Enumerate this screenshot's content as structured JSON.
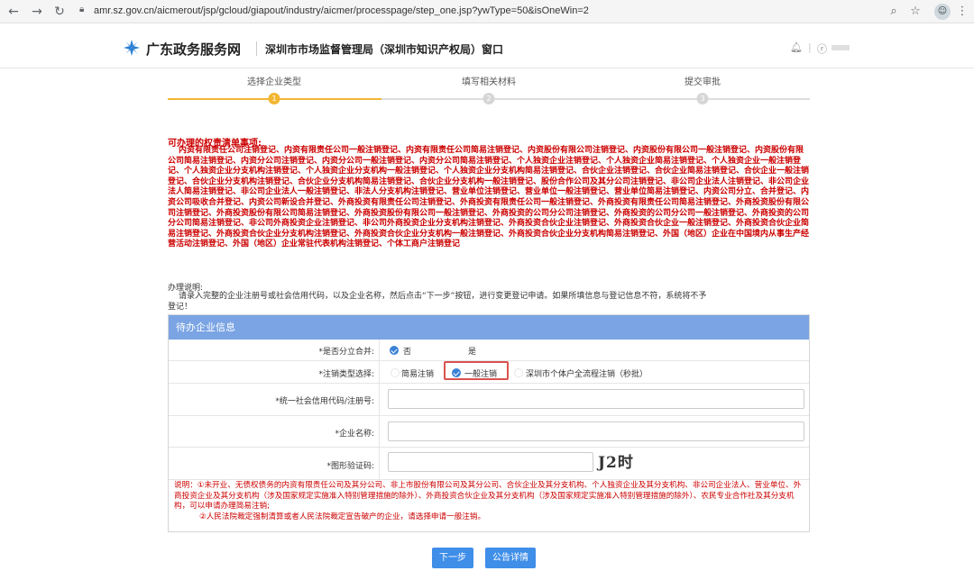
{
  "browser": {
    "url": "amr.sz.gov.cn/aicmerout/jsp/gcloud/giapout/industry/aicmer/processpage/step_one.jsp?ywType=50&isOneWin=2",
    "back_icon": "arrow-left-icon",
    "forward_icon": "arrow-right-icon",
    "reload_icon": "reload-icon",
    "menu_icon": "more-vert-icon"
  },
  "header": {
    "site_name": "广东政务服务网",
    "bureau": "深圳市市场监督管理局（深圳市知识产权局）窗口",
    "user_icon": "ⓡ",
    "brand_color": "#2a7fd4"
  },
  "steps": [
    {
      "label": "选择企业类型",
      "num": "1",
      "active": true
    },
    {
      "label": "填写相关材料",
      "num": "2",
      "active": false
    },
    {
      "label": "提交审批",
      "num": "3",
      "active": false
    }
  ],
  "notice": {
    "title": "可办理的权责清单事项:",
    "text": "内资有限责任公司注销登记、内资有限责任公司一般注销登记、内资有限责任公司简易注销登记、内资股份有限公司注销登记、内资股份有限公司一般注销登记、内资股份有限公司简易注销登记、内资分公司注销登记、内资分公司一般注销登记、内资分公司简易注销登记、个人独资企业注销登记、个人独资企业简易注销登记、个人独资企业一般注销登记、个人独资企业分支机构注销登记、个人独资企业分支机构一般注销登记、个人独资企业分支机构简易注销登记、合伙企业注销登记、合伙企业简易注销登记、合伙企业一般注销登记、合伙企业分支机构注销登记、合伙企业分支机构简易注销登记、合伙企业分支机构一般注销登记、股份合作公司及其分公司注销登记、非公司企业法人注销登记、非公司企业法人简易注销登记、非公司企业法人一般注销登记、非法人分支机构注销登记、营业单位注销登记、营业单位一般注销登记、营业单位简易注销登记、内资公司分立、合并登记、内资公司吸收合并登记、内资公司新设合并登记、外商投资有限责任公司注销登记、外商投资有限责任公司一般注销登记、外商投资有限责任公司简易注销登记、外商投资股份有限公司注销登记、外商投资股份有限公司简易注销登记、外商投资股份有限公司一般注销登记、外商投资的公司分公司注销登记、外商投资的公司分公司一般注销登记、外商投资的公司分公司简易注销登记、非公司外商投资企业注销登记、非公司外商投资企业分支机构注销登记、外商投资合伙企业注销登记、外商投资合伙企业一般注销登记、外商投资合伙企业简易注销登记、外商投资合伙企业分支机构注销登记、外商投资合伙企业分支机构一般注销登记、外商投资合伙企业分支机构简易注销登记、外国（地区）企业在中国境内从事生产经营活动注销登记、外国（地区）企业常驻代表机构注销登记、个体工商户注销登记"
  },
  "instructions": {
    "title": "办理说明:",
    "text": "请录入完整的企业注册号或社会信用代码，以及企业名称，然后点击“下一步”按钮，进行变更登记申请。如果所填信息与登记信息不符，系统将不予登记！"
  },
  "form": {
    "header": "待办企业信息",
    "split_merge_label": "*是否分立合并:",
    "split_merge_options": [
      "否",
      "是"
    ],
    "cancel_type_label": "*注销类型选择:",
    "cancel_type_options": [
      "简易注销",
      "一般注销",
      "深圳市个体户全流程注销（秒批）"
    ],
    "selected_cancel_type": "一般注销",
    "credit_code_label": "*统一社会信用代码/注册号:",
    "company_name_label": "*企业名称:",
    "captcha_label": "*图形验证码:",
    "captcha_text": "J2时"
  },
  "note": {
    "line1": "说明：①未开业、无债权债务的内资有限责任公司及其分公司、非上市股份有限公司及其分公司、合伙企业及其分支机构、个人独资企业及其分支机构、非公司企业法人、营业单位、外商投资企业及其分支机构（涉及国家规定实施准入特别管理措施的除外）、外商投资合伙企业及其分支机构（涉及国家规定实施准入特别管理措施的除外）、农民专业合作社及其分支机构，可以申请办理简易注销;",
    "line2": "②人民法院裁定强制清算或者人民法院裁定宣告破产的企业，请选择申请一般注销。"
  },
  "buttons": {
    "next": "下一步",
    "details": "公告详情"
  },
  "colors": {
    "accent": "#3f8ee8",
    "notice": "#cc0000",
    "step_active": "#f2b632",
    "form_header": "#7aa4e3"
  }
}
